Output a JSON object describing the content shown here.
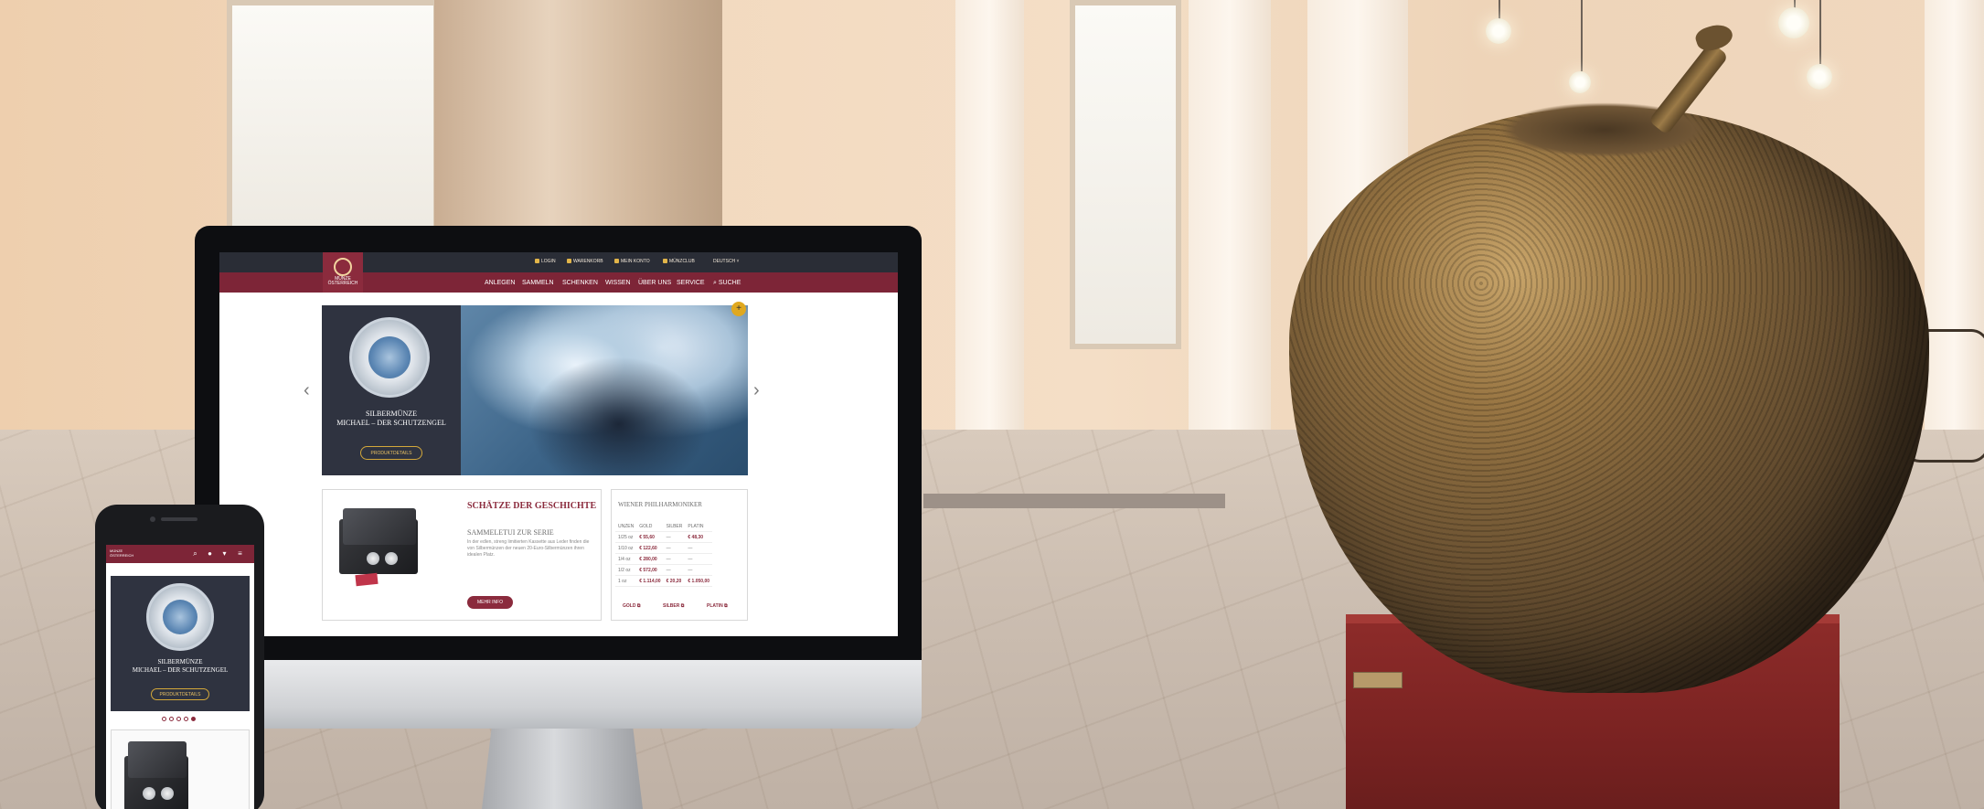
{
  "desktop": {
    "topbar": {
      "login": "LOGIN",
      "cart": "WARENKORB",
      "account": "MEIN KONTO",
      "club": "MÜNZCLUB",
      "language": "DEUTSCH ˅"
    },
    "logo": {
      "line1": "MÜNZE",
      "line2": "ÖSTERREICH"
    },
    "nav": [
      "ANLEGEN",
      "SAMMELN",
      "SCHENKEN",
      "WISSEN",
      "ÜBER UNS",
      "SERVICE",
      "SUCHE"
    ],
    "slider": {
      "title_line1": "SILBERMÜNZE",
      "title_line2": "MICHAEL – DER SCHUTZENGEL",
      "button": "PRODUKTDETAILS",
      "badge": "+"
    },
    "feature_card": {
      "title": "SCHÄTZE DER GESCHICHTE",
      "subtitle": "SAMMELETUI ZUR SERIE",
      "body": "In der edlen, streng limitierten Kassette aus Leder finden die von Silbermünzen der neuen 20-Euro-Silbermünzen ihren idealen Platz.",
      "button": "MEHR INFO"
    },
    "price_card": {
      "title": "WIENER PHILHARMONIKER",
      "headers": [
        "UNZEN",
        "GOLD",
        "SILBER",
        "PLATIN"
      ],
      "rows": [
        [
          "1/25 oz",
          "€ 55,60",
          "—",
          "€ 48,30"
        ],
        [
          "1/10 oz",
          "€ 122,60",
          "—",
          "—"
        ],
        [
          "1/4 oz",
          "€ 280,00",
          "—",
          "—"
        ],
        [
          "1/2 oz",
          "€ 572,00",
          "—",
          "—"
        ],
        [
          "1 oz",
          "€ 1.114,00",
          "€ 20,20",
          "€ 1.050,00"
        ]
      ],
      "links": [
        "GOLD ⧉",
        "SILBER ⧉",
        "PLATIN ⧉"
      ]
    }
  },
  "mobile": {
    "logo": {
      "line1": "MÜNZE",
      "line2": "ÖSTERREICH"
    },
    "icons": [
      "search-icon",
      "account-icon",
      "cart-icon",
      "menu-icon"
    ],
    "slider": {
      "title_line1": "SILBERMÜNZE",
      "title_line2": "MICHAEL – DER SCHUTZENGEL",
      "button": "PRODUKTDETAILS"
    },
    "carousel_dots": 5,
    "active_dot": 5
  },
  "colors": {
    "brand": "#7d2537",
    "accent_gold": "#d4a83a",
    "topbar": "#2a2d36"
  }
}
